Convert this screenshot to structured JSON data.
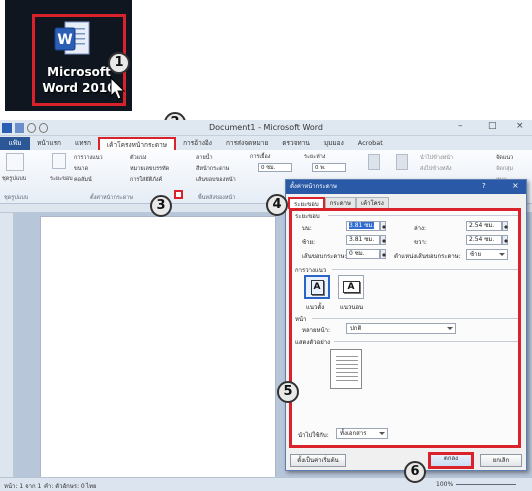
{
  "desktop": {
    "icon_label_line1": "Microsoft",
    "icon_label_line2": "Word 2010"
  },
  "callouts": [
    "1",
    "2",
    "3",
    "4",
    "5",
    "6"
  ],
  "window": {
    "title": "Document1 - Microsoft Word",
    "minimize": "–",
    "maximize": "□",
    "close": "×"
  },
  "tabs": [
    "แฟ้ม",
    "หน้าแรก",
    "แทรก",
    "เค้าโครงหน้ากระดาษ",
    "การอ้างอิง",
    "การส่งจดหมาย",
    "ตรวจทาน",
    "มุมมอง",
    "Acrobat"
  ],
  "ribbon": {
    "texts": [
      "ชุดรูปแบบ",
      "ระยะขอบ",
      "การวางแนว",
      "ขนาด",
      "คอลัมน์",
      "ตัวแบ่ง",
      "หมายเลขบรรทัด",
      "การใส่ยัติภังค์",
      "ลายน้ำ",
      "สีหน้ากระดาษ",
      "เส้นขอบของหน้า",
      "การเยื้อง",
      "ระยะห่าง",
      "0 ซม.",
      "0 พ.",
      "นำไปข้างหน้า",
      "ส่งไปข้างหลัง",
      "จัดแนว",
      "จัดกลุ่ม",
      "หมุน"
    ],
    "groups": [
      "ชุดรูปแบบ",
      "ตั้งค่าหน้ากระดาษ",
      "พื้นหลังของหน้า"
    ]
  },
  "status": {
    "page": "หน้า: 1 จาก 1",
    "words": "คำ: ตัวอักษร: 0",
    "lang": "ไทย",
    "zoom": "100%"
  },
  "dialog": {
    "title": "ตั้งค่าหน้ากระดาษ",
    "help": "?",
    "close": "×",
    "tabs": [
      "ระยะขอบ",
      "กระดาษ",
      "เค้าโครง"
    ],
    "margins_section": "ระยะขอบ",
    "top_label": "บน:",
    "top_value": "3.81 ซม.",
    "bottom_label": "ล่าง:",
    "bottom_value": "2.54 ซม.",
    "left_label": "ซ้าย:",
    "left_value": "3.81 ซม.",
    "right_label": "ขวา:",
    "right_value": "2.54 ซม.",
    "gutter_label": "เส้นขอบกระดาษ:",
    "gutter_value": "0 ซม.",
    "gutter_pos_label": "ตำแหน่งเส้นขอบกระดาษ:",
    "gutter_pos_value": "ซ้าย",
    "orientation_section": "การวางแนว",
    "portrait": "แนวตั้ง",
    "landscape": "แนวนอน",
    "pages_section": "หน้า",
    "multiple_pages_label": "หลายหน้า:",
    "multiple_pages_value": "ปกติ",
    "preview_section": "แสดงตัวอย่าง",
    "apply_to_label": "นำไปใช้กับ:",
    "apply_to_value": "ทั้งเอกสาร",
    "default_button": "ตั้งเป็นค่าเริ่มต้น",
    "ok_button": "ตกลง",
    "cancel_button": "ยกเลิก"
  }
}
